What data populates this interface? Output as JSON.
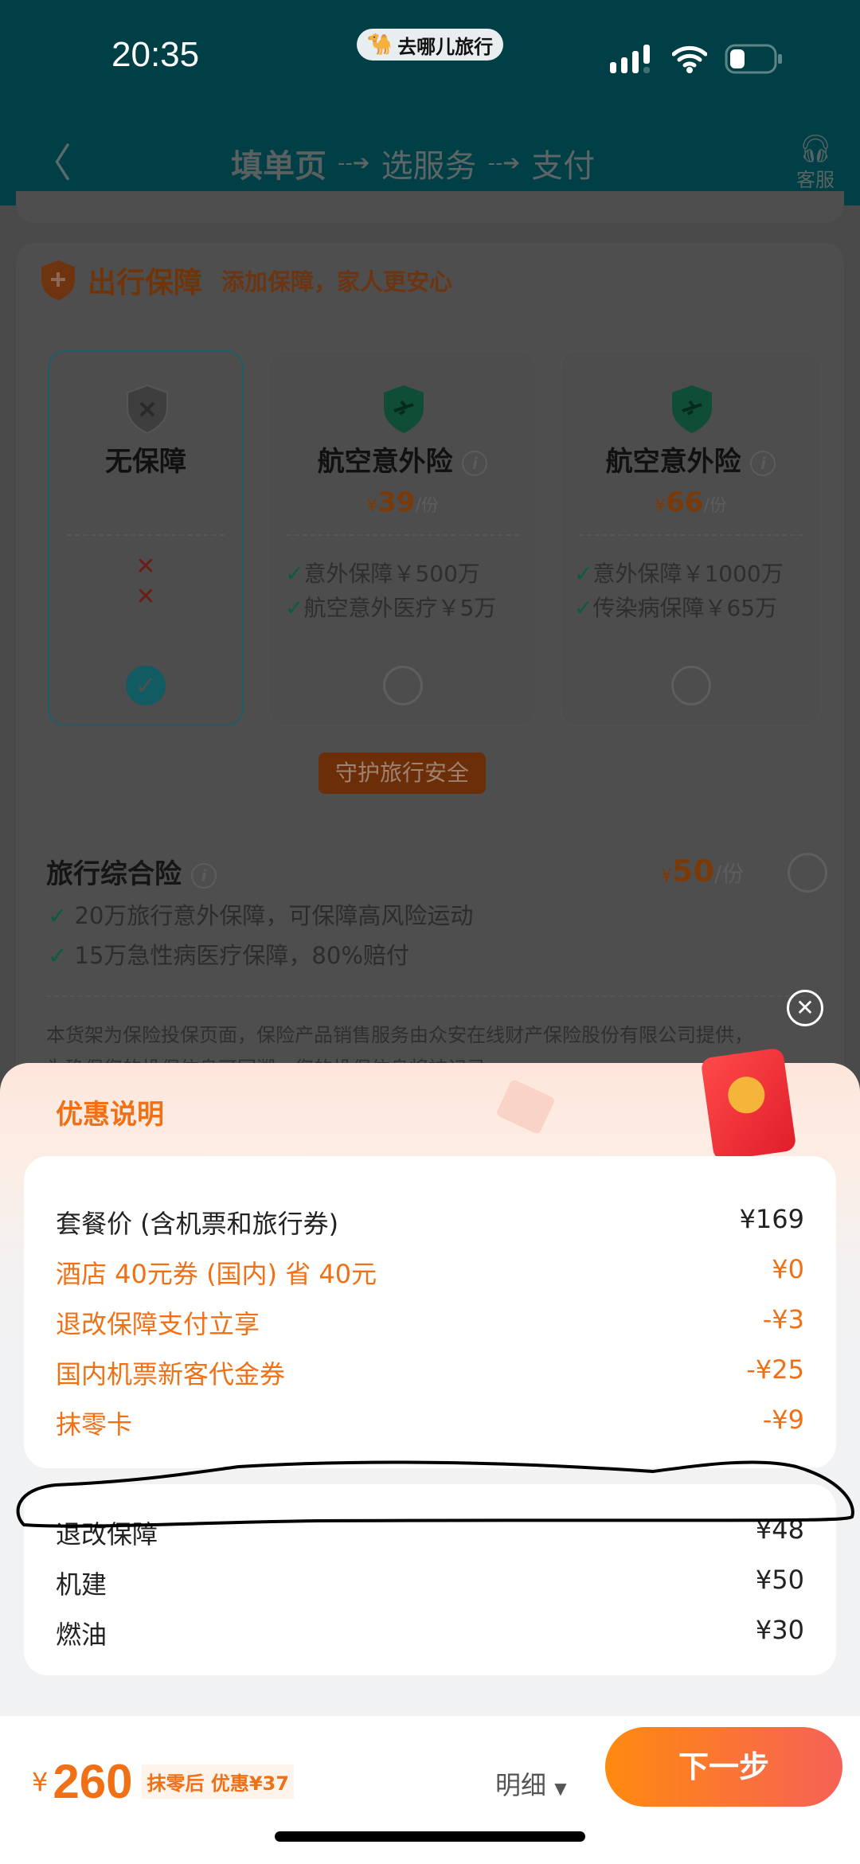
{
  "status_bar": {
    "time": "20:35",
    "app_badge": "去哪儿旅行",
    "icons": [
      "signal-icon",
      "wifi-icon",
      "battery-icon"
    ]
  },
  "nav": {
    "back_icon": "chevron-left-icon",
    "steps": [
      "填单页",
      "选服务",
      "支付"
    ],
    "service_label": "客服",
    "service_icon": "headset-icon"
  },
  "insurance": {
    "title": "出行保障",
    "subtitle": "添加保障，家人更安心",
    "options": [
      {
        "title": "无保障",
        "features": [
          "✕",
          "✕"
        ],
        "selected": true
      },
      {
        "title": "航空意外险",
        "currency": "¥",
        "price": "39",
        "unit": "/份",
        "features": [
          "意外保障￥500万",
          "航空意外医疗￥5万"
        ],
        "selected": false
      },
      {
        "title": "航空意外险",
        "currency": "¥",
        "price": "66",
        "unit": "/份",
        "features": [
          "意外保障￥1000万",
          "传染病保障￥65万"
        ],
        "selected": false
      }
    ],
    "tag": "守护旅行安全",
    "travel": {
      "title": "旅行综合险",
      "currency": "¥",
      "price": "50",
      "unit": "/份",
      "features": [
        "20万旅行意外保障，可保障高风险运动",
        "15万急性病医疗保障，80%赔付"
      ],
      "selected": false
    },
    "disclaimer": "本货架为保险投保页面，保险产品销售服务由众安在线财产保险股份有限公司提供，",
    "disclaimer_2": "为确保您的投保信息可回溯，您的投保信息将被记录"
  },
  "sheet": {
    "title": "优惠说明",
    "discounts": [
      {
        "label": "套餐价 (含机票和旅行券)",
        "value": "¥169",
        "highlight": false
      },
      {
        "label": "酒店 40元券 (国内) 省 40元",
        "value": "¥0",
        "highlight": true
      },
      {
        "label": "退改保障支付立享",
        "value": "-¥3",
        "highlight": true
      },
      {
        "label": "国内机票新客代金券",
        "value": "-¥25",
        "highlight": true
      },
      {
        "label": "抹零卡",
        "value": "-¥9",
        "highlight": true
      }
    ],
    "extras": [
      {
        "label": "退改保障",
        "value": "¥48"
      },
      {
        "label": "机建",
        "value": "¥50"
      },
      {
        "label": "燃油",
        "value": "¥30"
      }
    ]
  },
  "footer": {
    "currency": "¥",
    "total": "260",
    "discount_note": "抹零后 优惠¥37",
    "detail_label": "明细",
    "next_label": "下一步"
  },
  "colors": {
    "accent": "#f07016",
    "teal": "#125b62",
    "button_from": "#ff8a10",
    "button_to": "#f66156"
  }
}
